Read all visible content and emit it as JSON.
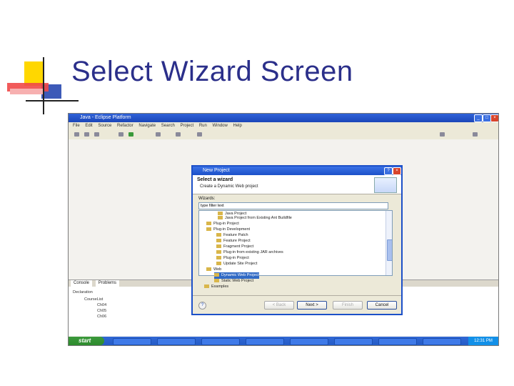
{
  "slide": {
    "title": "Select Wizard Screen"
  },
  "colors": {
    "title": "#2b2f8a",
    "accent_yellow": "#ffd700",
    "accent_red": "#f04848",
    "accent_blue": "#3d5ab8"
  },
  "eclipse": {
    "title": "Java - Eclipse Platform",
    "menu": [
      "File",
      "Edit",
      "Source",
      "Refactor",
      "Navigate",
      "Search",
      "Project",
      "Run",
      "Window",
      "Help"
    ]
  },
  "dialog": {
    "title": "New Project",
    "heading": "Select a wizard",
    "description": "Create a Dynamic Web project",
    "wizards_label": "Wizards:",
    "filter_value": "type filter text",
    "tree": [
      "Java Project",
      "Java Project from Existing Ant Buildfile",
      "Plug-in Project",
      "Plug-in Development",
      "Feature Patch",
      "Feature Project",
      "Fragment Project",
      "Plug-in from existing JAR archives",
      "Plug-in Project",
      "Update Site Project",
      "Web",
      "Dynamic Web Project",
      "Static Web Project",
      "Examples"
    ],
    "selected_index": 11,
    "buttons": {
      "back": "< Back",
      "next": "Next >",
      "finish": "Finish",
      "cancel": "Cancel"
    }
  },
  "bottom_panel": {
    "tabs": [
      "Console",
      "Problems"
    ],
    "rows": [
      "Declaration",
      "CourseList",
      "Ch04",
      "Ch05",
      "Ch06"
    ]
  },
  "taskbar": {
    "start": "start",
    "clock": "12:31 PM"
  }
}
